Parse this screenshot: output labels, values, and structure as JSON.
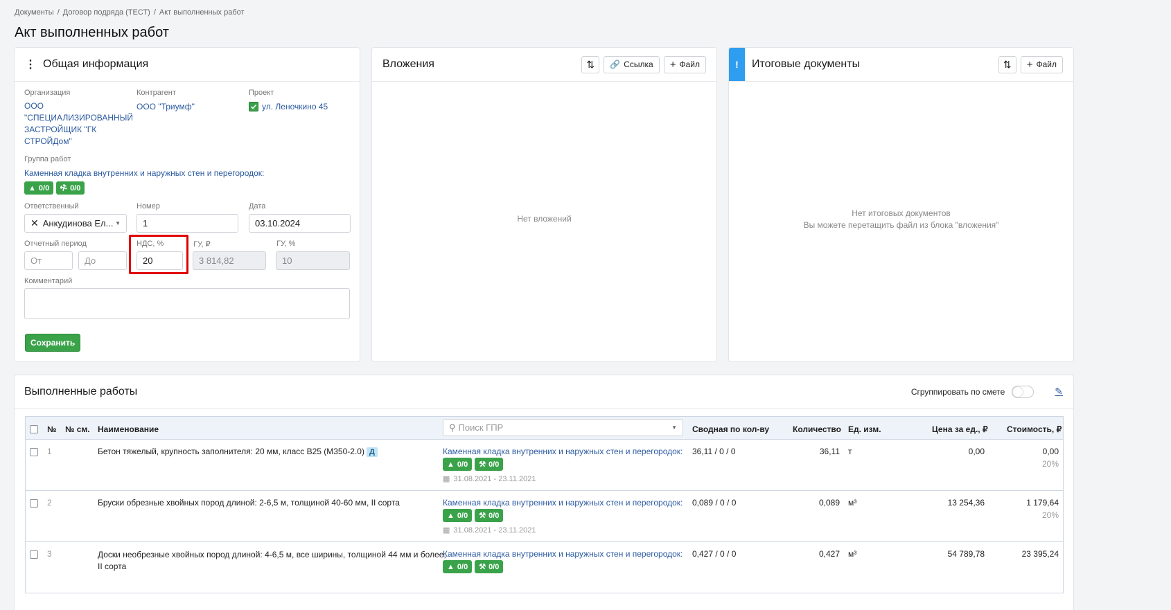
{
  "breadcrumb": {
    "items": [
      "Документы",
      "Договор подряда (ТЕСТ)",
      "Акт выполненных работ"
    ],
    "sep": "/"
  },
  "page_title": "Акт выполненных работ",
  "general": {
    "title": "Общая информация",
    "org_label": "Организация",
    "org_lines": [
      "ООО",
      "\"СПЕЦИАЛИЗИРОВАННЫЙ",
      "ЗАСТРОЙЩИК \"ГК",
      "СТРОЙДом\""
    ],
    "contractor_label": "Контрагент",
    "contractor": "ООО \"Триумф\"",
    "project_label": "Проект",
    "project": "ул. Леночкино 45",
    "group_label": "Группа работ",
    "group": "Каменная кладка внутренних и наружных стен и перегородок:",
    "badge_warn": "0/0",
    "badge_tool": "0/0",
    "resp_label": "Ответственный",
    "resp_value": "Анкудинова Ел...",
    "number_label": "Номер",
    "number_value": "1",
    "date_label": "Дата",
    "date_value": "03.10.2024",
    "period_label": "Отчетный период",
    "period_from": "От",
    "period_to": "До",
    "vat_label": "НДС, %",
    "vat_value": "20",
    "gu_rub_label": "ГУ, ₽",
    "gu_rub_value": "3 814,82",
    "gu_pct_label": "ГУ, %",
    "gu_pct_value": "10",
    "comment_label": "Комментарий",
    "save": "Сохранить"
  },
  "attachments": {
    "title": "Вложения",
    "link_btn": "Ссылка",
    "file_btn": "Файл",
    "empty": "Нет вложений"
  },
  "final_docs": {
    "title": "Итоговые документы",
    "marker": "!",
    "file_btn": "Файл",
    "empty1": "Нет итоговых документов",
    "empty2": "Вы можете перетащить файл из блока \"вложения\""
  },
  "works": {
    "title": "Выполненные работы",
    "group_toggle": "Сгруппировать по смете",
    "group_toggle_on": false,
    "search_placeholder": "Поиск ГПР",
    "columns": {
      "num": "№",
      "est": "№ см.",
      "name": "Наименование",
      "summary": "Сводная по кол-ву",
      "qty": "Количество",
      "unit": "Ед. изм.",
      "price": "Цена за ед., ₽",
      "cost": "Стоимость, ₽"
    },
    "rows": [
      {
        "num": "1",
        "name": "Бетон тяжелый, крупность заполнителя: 20 мм, класс В25 (М350-2.0)",
        "name2": "",
        "tag": "Д",
        "group": "Каменная кладка внутренних и наружных стен и перегородок:",
        "b1": "0/0",
        "b2": "0/0",
        "dates": "31.08.2021 - 23.11.2021",
        "summary": "36,11 / 0 / 0",
        "qty": "36,11",
        "unit": "т",
        "price": "0,00",
        "cost": "0,00",
        "vat": "20%"
      },
      {
        "num": "2",
        "name": "Бруски обрезные хвойных пород длиной: 2-6,5 м, толщиной 40-60 мм, II сорта",
        "name2": "",
        "tag": "",
        "group": "Каменная кладка внутренних и наружных стен и перегородок:",
        "b1": "0/0",
        "b2": "0/0",
        "dates": "31.08.2021 - 23.11.2021",
        "summary": "0,089 / 0 / 0",
        "qty": "0,089",
        "unit": "м³",
        "price": "13 254,36",
        "cost": "1 179,64",
        "vat": "20%"
      },
      {
        "num": "3",
        "name": "Доски необрезные хвойных пород длиной: 4-6,5 м, все ширины, толщиной 44 мм и более,",
        "name2": "II сорта",
        "tag": "",
        "group": "Каменная кладка внутренних и наружных стен и перегородок:",
        "b1": "0/0",
        "b2": "0/0",
        "dates": "",
        "summary": "0,427 / 0 / 0",
        "qty": "0,427",
        "unit": "м³",
        "price": "54 789,78",
        "cost": "23 395,24",
        "vat": ""
      }
    ]
  },
  "colors": {
    "green": "#3aa34a",
    "link": "#2c5aa0",
    "highlight": "#e00000",
    "info": "#2f9df0"
  }
}
